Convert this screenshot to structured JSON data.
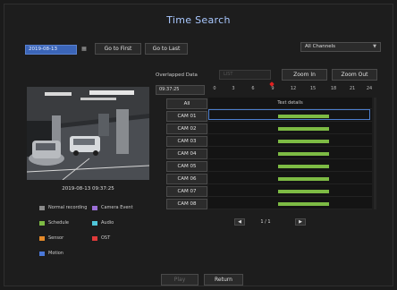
{
  "title": "Time Search",
  "date_value": "2019-08-13",
  "go_first_label": "Go to First",
  "go_last_label": "Go to Last",
  "channel_select": "All Channels",
  "overlapped_label": "Overlapped Data",
  "overlapped_value": "LIST",
  "zoom_in_label": "Zoom In",
  "zoom_out_label": "Zoom Out",
  "time_value": "09:37:25",
  "timeline_ticks": [
    "0",
    "3",
    "6",
    "9",
    "12",
    "15",
    "18",
    "21",
    "24"
  ],
  "text_details_label": "Text details",
  "channels": [
    "All",
    "CAM 01",
    "CAM 02",
    "CAM 03",
    "CAM 04",
    "CAM 05",
    "CAM 06",
    "CAM 07",
    "CAM 08"
  ],
  "timestamp": "2019-08-13 09:37:25",
  "legend": [
    {
      "label": "Normal recording",
      "color": "#8a8a8a"
    },
    {
      "label": "Camera Event",
      "color": "#9b6fd6"
    },
    {
      "label": "Schedule",
      "color": "#7dbb44"
    },
    {
      "label": "Audio",
      "color": "#4fc6d9"
    },
    {
      "label": "Sensor",
      "color": "#e58a2a"
    },
    {
      "label": "OST",
      "color": "#e03a3a"
    },
    {
      "label": "Motion",
      "color": "#4a78d8"
    }
  ],
  "page": "1 / 1",
  "play_label": "Play",
  "return_label": "Return",
  "colors": {
    "accent": "#3b65b8",
    "record": "#7dbb44",
    "title": "#a9c8ff"
  }
}
